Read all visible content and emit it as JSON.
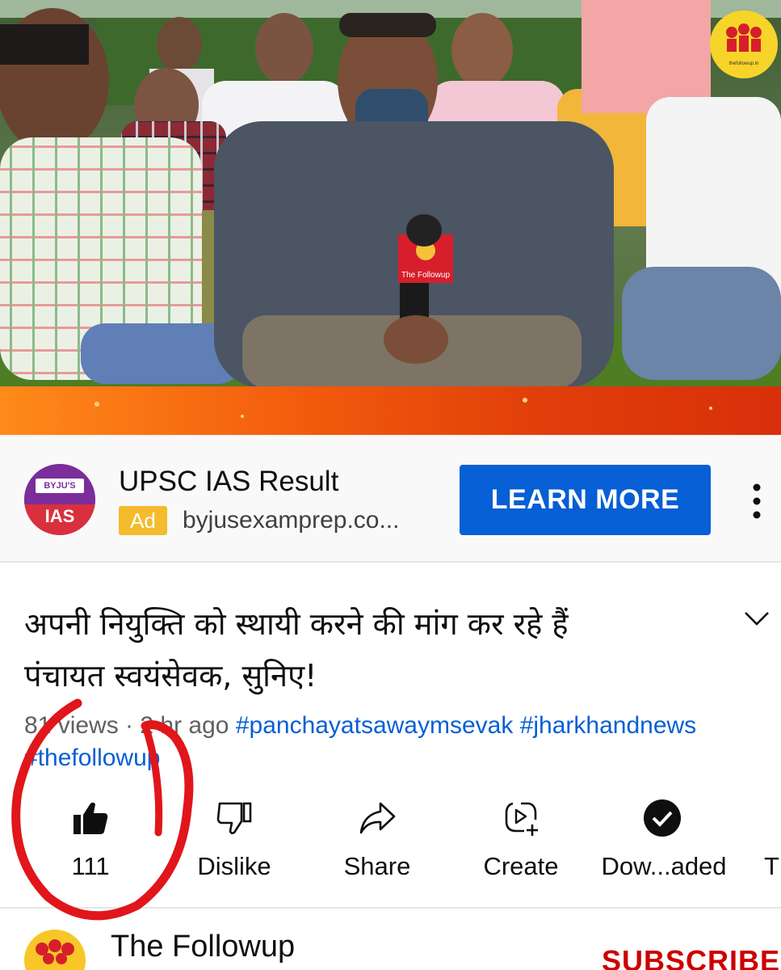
{
  "video": {
    "mic_flag_text": "The Followup",
    "watermark_text": "thefollowup.in"
  },
  "ad": {
    "logo_brand": "BYJU'S",
    "logo_text": "IAS",
    "title": "UPSC IAS Result",
    "badge": "Ad",
    "domain": "byjusexamprep.co...",
    "cta": "LEARN MORE"
  },
  "video_title": {
    "line1": "अपनी नियुक्ति को स्थायी करने की मांग कर रहे हैं",
    "line2": "पंचायत स्वयंसेवक, सुनिए!"
  },
  "meta": {
    "views": "81  views",
    "separator": " · ",
    "age": "2 hr ago",
    "tags": [
      "#panchayatsawaymsevak",
      "#jharkhandnews",
      "#thefollowup"
    ]
  },
  "actions": {
    "like": "111",
    "dislike": "Dislike",
    "share": "Share",
    "create": "Create",
    "download": "Dow...aded",
    "more": "T"
  },
  "channel": {
    "name": "The Followup",
    "subscribe": "SUBSCRIBE"
  },
  "colors": {
    "accent_blue": "#065fd4",
    "ad_badge": "#f4bb2c",
    "subscribe_red": "#cc0000",
    "annotation_red": "#e0161b"
  },
  "icons": [
    "thumbs-up-icon",
    "thumbs-down-icon",
    "share-arrow-icon",
    "create-icon",
    "downloaded-check-icon",
    "kebab-menu-icon",
    "chevron-down-icon"
  ]
}
